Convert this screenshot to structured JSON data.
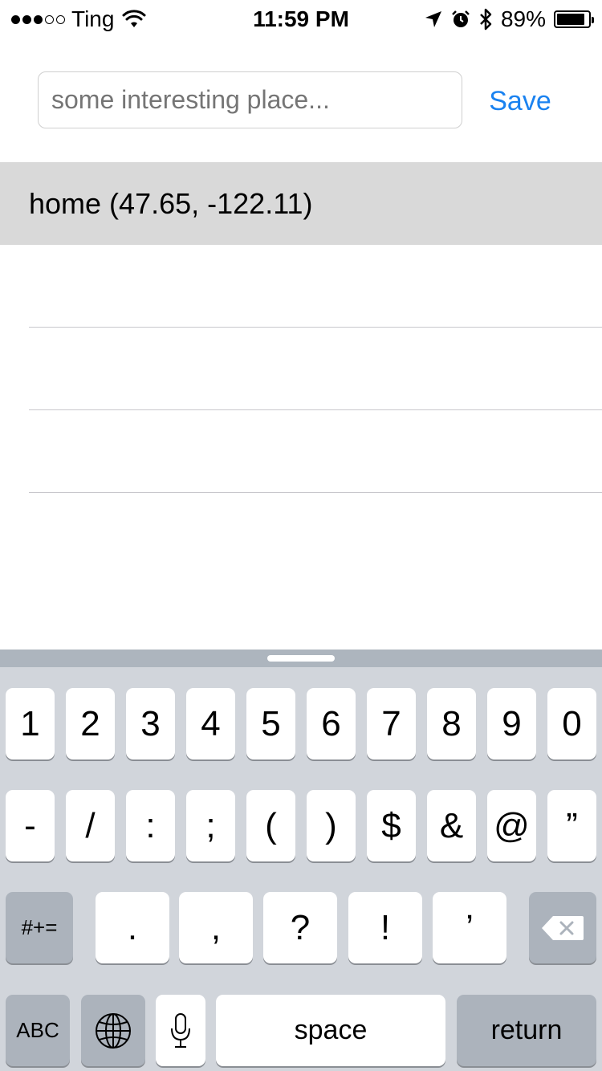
{
  "status_bar": {
    "carrier": "Ting",
    "time": "11:59 PM",
    "battery_percent": "89%",
    "battery_level": 0.89,
    "signal_bars_filled": 3,
    "signal_bars_total": 5
  },
  "place_input": {
    "value": "",
    "placeholder": "some interesting place..."
  },
  "save_label": "Save",
  "places": [
    {
      "label": "home (47.65, -122.11)",
      "selected": true
    },
    {
      "label": ""
    },
    {
      "label": ""
    },
    {
      "label": ""
    },
    {
      "label": ""
    }
  ],
  "keyboard": {
    "row1": [
      "1",
      "2",
      "3",
      "4",
      "5",
      "6",
      "7",
      "8",
      "9",
      "0"
    ],
    "row2": [
      "-",
      "/",
      ":",
      ";",
      "(",
      ")",
      "$",
      "&",
      "@",
      "”"
    ],
    "row3_left": "#+=",
    "row3": [
      ".",
      ",",
      "?",
      "!",
      "’"
    ],
    "abc_label": "ABC",
    "space_label": "space",
    "return_label": "return",
    "icons": {
      "delete": "delete-icon",
      "globe": "globe-icon",
      "mic": "microphone-icon"
    }
  },
  "colors": {
    "accent": "#1a82f0",
    "selected_row": "#d9d9d9",
    "keyboard_bg": "#d1d5db"
  }
}
